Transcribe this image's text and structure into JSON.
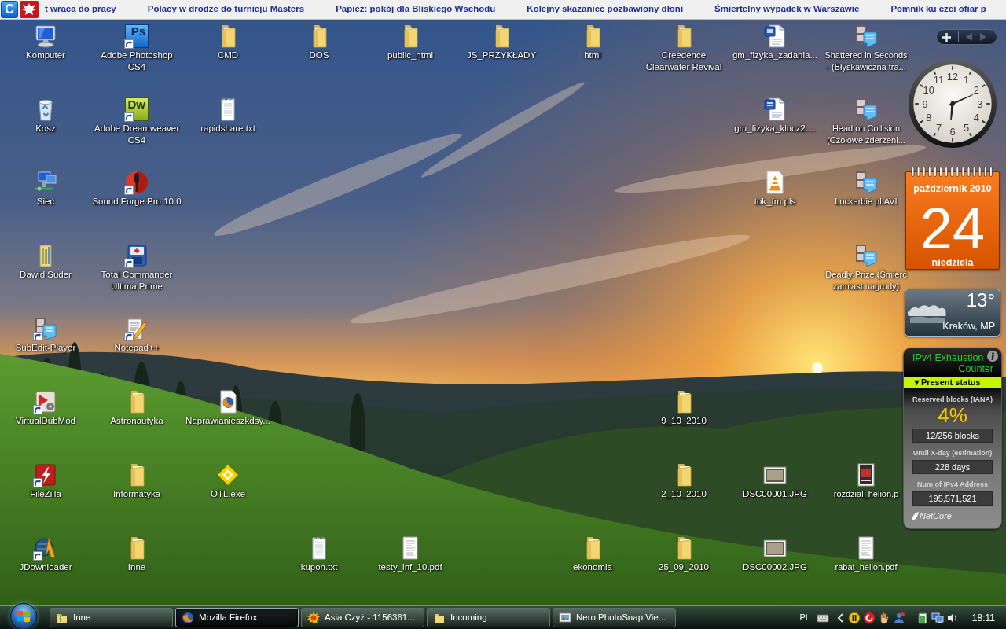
{
  "ticker": {
    "logo_letter": "C",
    "headlines": [
      "t wraca do pracy",
      "Polacy w drodze do turnieju Masters",
      "Papież: pokój dla Bliskiego Wschodu",
      "Kolejny skazaniec pozbawiony dłoni",
      "Śmiertelny wypadek w Warszawie",
      "Pomnik ku czci ofiar p"
    ]
  },
  "desktop": {
    "icons": [
      {
        "label": "Komputer",
        "kind": "computer",
        "shortcut": false
      },
      {
        "label": "Adobe Photoshop CS4",
        "kind": "photoshop",
        "logo_text": "Ps",
        "shortcut": true
      },
      {
        "label": "CMD",
        "kind": "folder",
        "shortcut": false
      },
      {
        "label": "DOS",
        "kind": "folder",
        "shortcut": false
      },
      {
        "label": "public_html",
        "kind": "folder",
        "shortcut": false
      },
      {
        "label": "JS_PRZYKŁADY",
        "kind": "folder",
        "shortcut": false
      },
      {
        "label": "html",
        "kind": "folder",
        "shortcut": false
      },
      {
        "label": "Creedence Clearwater Revival",
        "kind": "folder",
        "shortcut": false
      },
      {
        "label": "gm_fizyka_zadania...",
        "kind": "word-doc",
        "shortcut": false
      },
      {
        "label": "Shattered in Seconds - (Błyskawiczna tra...",
        "kind": "video",
        "shortcut": false
      },
      {
        "label": "Kosz",
        "kind": "recycle-bin",
        "shortcut": false
      },
      {
        "label": "Adobe Dreamweaver CS4",
        "kind": "dreamweaver",
        "logo_text": "Dw",
        "shortcut": true
      },
      {
        "label": "rapidshare.txt",
        "kind": "text-file",
        "shortcut": false
      },
      {
        "label": "gm_fizyka_klucz2....",
        "kind": "word-doc",
        "shortcut": false
      },
      {
        "label": "Head on Collision (Czołowe zderzeni...",
        "kind": "video",
        "shortcut": false
      },
      {
        "label": "Sieć",
        "kind": "network",
        "shortcut": false
      },
      {
        "label": "Sound Forge Pro 10.0",
        "kind": "sound-forge",
        "shortcut": true
      },
      {
        "label": "tok_fm.pls",
        "kind": "playlist",
        "shortcut": false
      },
      {
        "label": "Lockerbie pl.AVI",
        "kind": "video",
        "shortcut": false
      },
      {
        "label": "Dawid Suder",
        "kind": "user-folder",
        "shortcut": false
      },
      {
        "label": "Total Commander Ultima Prime",
        "kind": "total-commander",
        "shortcut": true
      },
      {
        "label": "Deadly Prize (Śmierć zamiast nagrody)",
        "kind": "video",
        "shortcut": false
      },
      {
        "label": "SubEdit-Player",
        "kind": "video",
        "shortcut": true
      },
      {
        "label": "Notepad++",
        "kind": "notepad",
        "shortcut": true
      },
      {
        "label": "VirtualDubMod",
        "kind": "virtualdub",
        "shortcut": true
      },
      {
        "label": "Astronautyka",
        "kind": "folder",
        "shortcut": false
      },
      {
        "label": "Naprawianieszkdsy...",
        "kind": "html-file",
        "shortcut": false
      },
      {
        "label": "9_10_2010",
        "kind": "folder",
        "shortcut": false
      },
      {
        "label": "FileZilla",
        "kind": "filezilla",
        "shortcut": true
      },
      {
        "label": "Informatyka",
        "kind": "folder",
        "shortcut": false
      },
      {
        "label": "OTL.exe",
        "kind": "otl",
        "shortcut": false
      },
      {
        "label": "2_10_2010",
        "kind": "folder",
        "shortcut": false
      },
      {
        "label": "DSC00001.JPG",
        "kind": "photo",
        "shortcut": false
      },
      {
        "label": "rozdzial_helion.p",
        "kind": "book-cover",
        "shortcut": false
      },
      {
        "label": "JDownloader",
        "kind": "jdownloader",
        "shortcut": true
      },
      {
        "label": "Inne",
        "kind": "folder",
        "shortcut": false
      },
      {
        "label": "kupon.txt",
        "kind": "text-file",
        "shortcut": false
      },
      {
        "label": "testy_inf_10.pdf",
        "kind": "pdf",
        "shortcut": false
      },
      {
        "label": "ekonomia",
        "kind": "folder",
        "shortcut": false
      },
      {
        "label": "25_09_2010",
        "kind": "folder",
        "shortcut": false
      },
      {
        "label": "DSC00002.JPG",
        "kind": "photo",
        "shortcut": false
      },
      {
        "label": "rabat_helion.pdf",
        "kind": "pdf",
        "shortcut": false
      }
    ]
  },
  "gadgets": {
    "toolbar": {
      "previous": {
        "disabled": true
      },
      "next": {
        "disabled": true
      }
    },
    "clock": {
      "numerals": [
        "12",
        "11",
        "1",
        "10",
        "2",
        "9",
        "3",
        "8",
        "4",
        "7",
        "5",
        "6"
      ]
    },
    "calendar": {
      "month": "październik 2010",
      "day": "24",
      "weekday": "niedziela"
    },
    "weather": {
      "temperature": "13°",
      "location": "Kraków, MP"
    },
    "ipv4_counter": {
      "title": [
        "IPv4 Exhaustion",
        "Counter"
      ],
      "section": "▼Present status",
      "stats": [
        {
          "kind": "percent",
          "label": "Reserved blocks (IANA)",
          "value": "4%",
          "detail": "12/256 blocks"
        },
        {
          "kind": "box",
          "label": "Until X-day (estimation)",
          "value": "228 days"
        },
        {
          "kind": "box",
          "label": "Num of IPv4 Address",
          "value": "195,571,521"
        }
      ],
      "logo": "NetCore"
    }
  },
  "taskbar": {
    "buttons": [
      {
        "label": "Inne",
        "kind": "library-folder",
        "selected": false
      },
      {
        "label": "Mozilla Firefox",
        "kind": "browser",
        "selected": true
      },
      {
        "label": "Asia Czyż - 1156361...",
        "kind": "messenger",
        "selected": false
      },
      {
        "label": "Incoming",
        "kind": "folder",
        "selected": false
      },
      {
        "label": "Nero PhotoSnap Vie...",
        "kind": "viewer",
        "selected": false
      }
    ],
    "language": "PL",
    "time": "18:11"
  }
}
